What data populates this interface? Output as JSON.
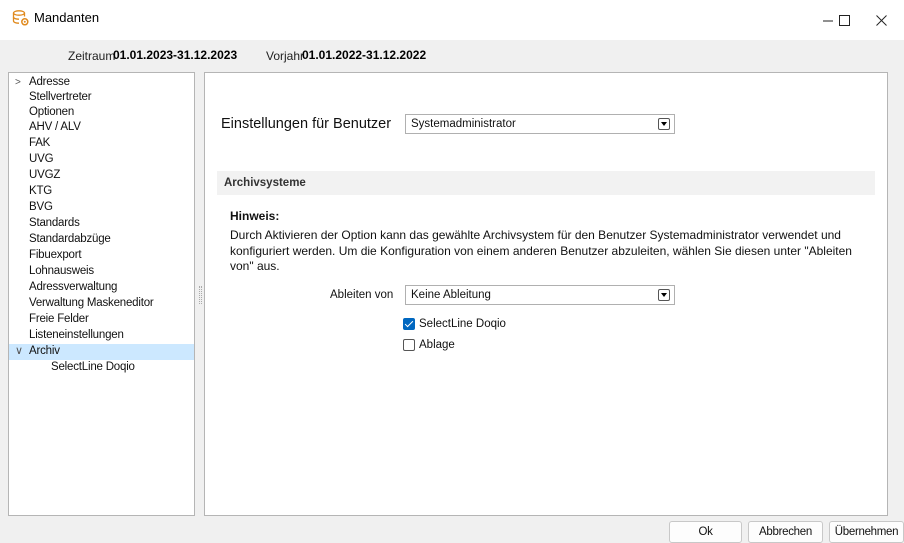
{
  "window": {
    "title": "Mandanten",
    "minimize_glyph": "—",
    "maximize_glyph": "☐",
    "close_glyph": "✕",
    "icon": "database-gear-icon"
  },
  "period": {
    "zeitraum_label": "Zeitraum",
    "zeitraum_value": "01.01.2023-31.12.2023",
    "vorjahr_label": "Vorjahr",
    "vorjahr_value": "01.01.2022-31.12.2022"
  },
  "tree": {
    "expand_collapsed": ">",
    "expand_open": "∨",
    "items": [
      "Adresse",
      "Stellvertreter",
      "Optionen",
      "AHV / ALV",
      "FAK",
      "UVG",
      "UVGZ",
      "KTG",
      "BVG",
      "Standards",
      "Standardabzüge",
      "Fibuexport",
      "Lohnausweis",
      "Adressverwaltung",
      "Verwaltung Maskeneditor",
      "Freie Felder",
      "Listeneinstellungen",
      "Archiv",
      "SelectLine Doqio"
    ]
  },
  "main": {
    "settings_label": "Einstellungen für Benutzer",
    "user_value": "Systemadministrator",
    "section_title": "Archivsysteme",
    "hint_title": "Hinweis:",
    "hint_text": "Durch Aktivieren der Option kann das gewählte Archivsystem für den Benutzer Systemadministrator verwendet und konfiguriert werden. Um die Konfiguration von einem anderen Benutzer abzuleiten, wählen Sie diesen unter \"Ableiten von\" aus.",
    "derive_label": "Ableiten von",
    "derive_value": "Keine Ableitung",
    "checkboxes": [
      {
        "label": "SelectLine Doqio",
        "checked": true
      },
      {
        "label": "Ablage",
        "checked": false
      }
    ]
  },
  "footer": {
    "ok": "Ok",
    "cancel": "Abbrechen",
    "apply": "Übernehmen"
  },
  "colors": {
    "selection": "#cce8ff",
    "accent": "#0067c0",
    "icon_orange": "#e8a33d"
  }
}
